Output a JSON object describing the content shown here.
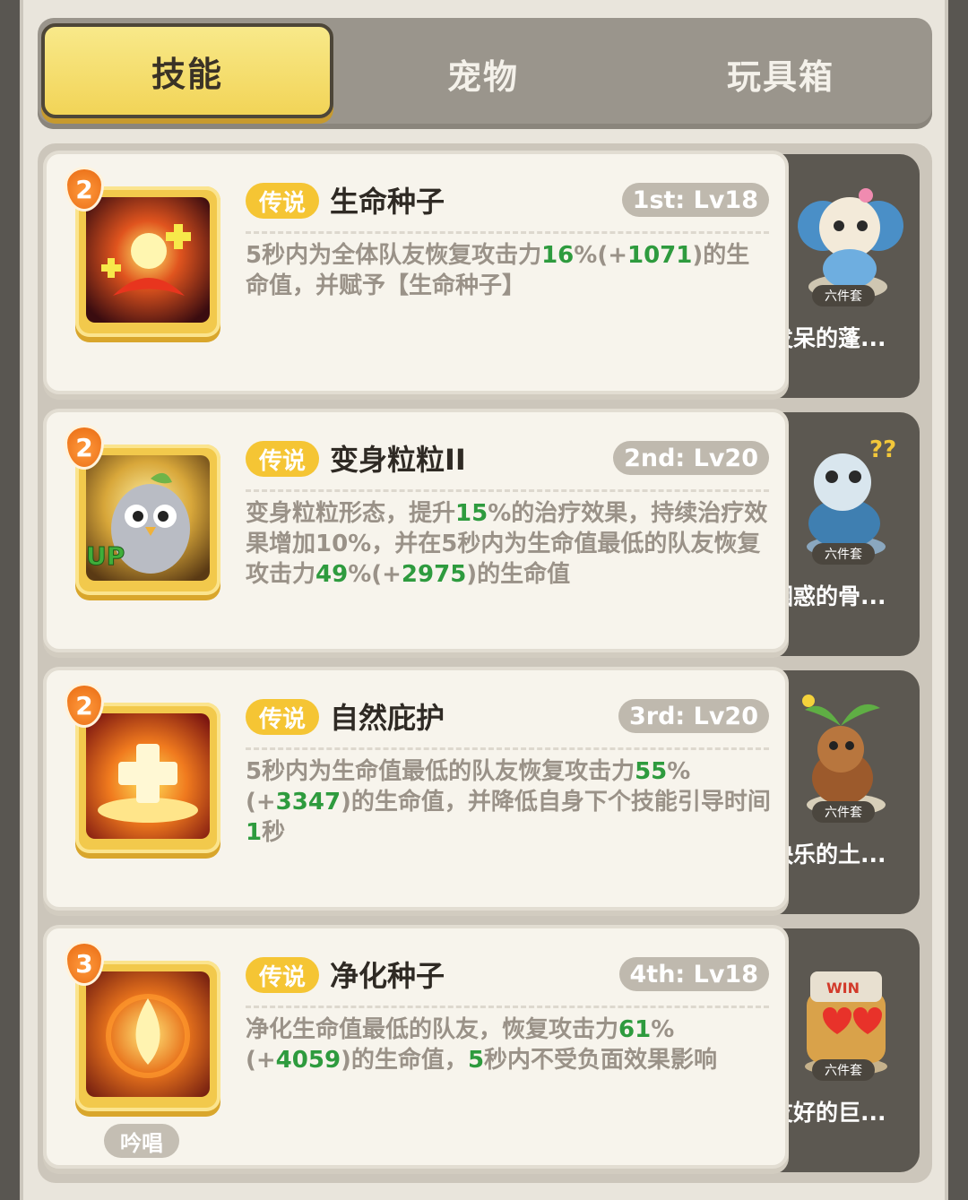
{
  "tabs": [
    {
      "label": "技能",
      "active": true
    },
    {
      "label": "宠物",
      "active": false
    },
    {
      "label": "玩具箱",
      "active": false
    }
  ],
  "skills": [
    {
      "level_badge": "2",
      "rarity": "传说",
      "name": "生命种子",
      "order": "1st: Lv18",
      "desc_parts": [
        "5秒内为全体队友恢复攻击力",
        "16",
        "%(+",
        "1071",
        ")的生命值，并赋予【生命种子】"
      ],
      "pet_tag": "六件套",
      "pet_name": "发呆的蓬..."
    },
    {
      "level_badge": "2",
      "rarity": "传说",
      "name": "变身粒粒II",
      "order": "2nd: Lv20",
      "desc_parts": [
        "变身粒粒形态，提升",
        "15",
        "%的治疗效果，持续治疗效果增加10%，并在5秒内为生命值最低的队友恢复攻击力",
        "49",
        "%(+",
        "2975",
        ")的生命值"
      ],
      "icon_label": "UP",
      "pet_tag": "六件套",
      "pet_name": "困惑的骨..."
    },
    {
      "level_badge": "2",
      "rarity": "传说",
      "name": "自然庇护",
      "order": "3rd: Lv20",
      "desc_parts": [
        "5秒内为生命值最低的队友恢复攻击力",
        "55",
        "%(+",
        "3347",
        ")的生命值，并降低自身下个技能引导时间",
        "1",
        "秒"
      ],
      "pet_tag": "六件套",
      "pet_name": "快乐的土..."
    },
    {
      "level_badge": "3",
      "rarity": "传说",
      "name": "净化种子",
      "order": "4th: Lv18",
      "desc_parts": [
        "净化生命值最低的队友，恢复攻击力",
        "61",
        "%(+",
        "4059",
        ")的生命值，",
        "5",
        "秒内不受负面效果影响"
      ],
      "chant": "吟唱",
      "pet_tag": "六件套",
      "pet_name": "友好的巨..."
    }
  ]
}
